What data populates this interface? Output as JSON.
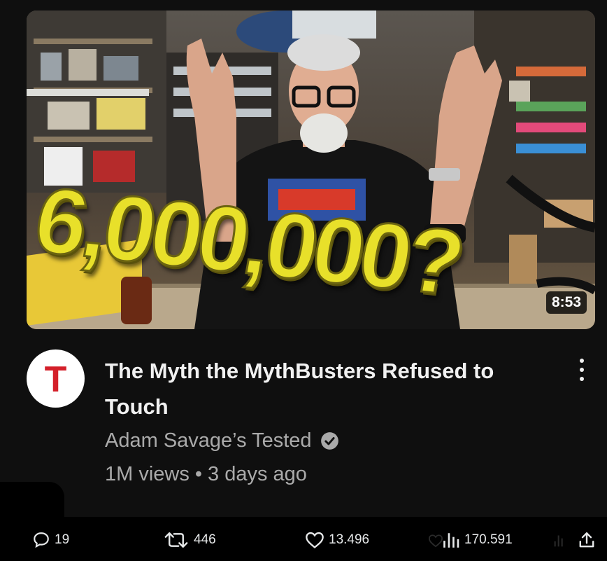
{
  "video": {
    "thumbnail_overlay_text": "6,000,000?",
    "duration": "8:53",
    "title": "The Myth the MythBusters Refused to Touch",
    "channel_name": "Adam Savage’s Tested",
    "channel_avatar_letter": "T",
    "views": "1M views",
    "separator": "•",
    "age": "3 days ago"
  },
  "post_actions": {
    "replies": "19",
    "reposts": "446",
    "likes": "13.496",
    "views": "170.591"
  },
  "icons": {
    "more": "more-vertical-icon",
    "verified": "verified-check-icon",
    "replies": "speech-bubble-icon",
    "reposts": "repost-arrows-icon",
    "likes": "heart-icon",
    "views": "bar-chart-icon",
    "share": "share-upload-icon"
  },
  "colors": {
    "card_background": "#0f0f0f",
    "page_background": "#000000",
    "secondary_text": "#aaaaaa",
    "overlay_yellow": "#e8e02a",
    "avatar_red": "#d4202a"
  }
}
